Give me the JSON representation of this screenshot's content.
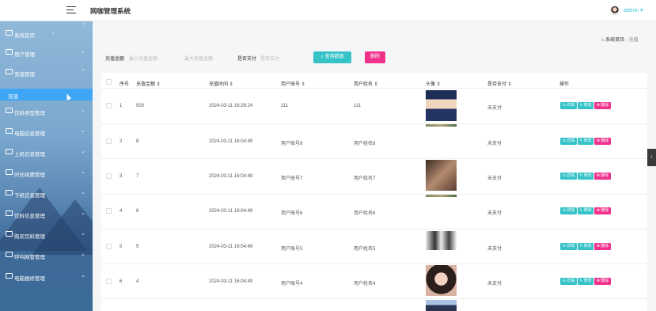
{
  "app": {
    "title": "网咖管理系统",
    "user": "admin ▾"
  },
  "sidebar": {
    "close": "×",
    "items": [
      {
        "label": "系统首页",
        "chevron": "⌄"
      },
      {
        "label": "用户管理",
        "chevron": "⌄"
      },
      {
        "label": "充值管理",
        "chevron": "⌃"
      },
      {
        "label": "饮料类型管理",
        "chevron": "⌄"
      },
      {
        "label": "电脑信息管理",
        "chevron": "⌄"
      },
      {
        "label": "上机信息管理",
        "chevron": "⌄"
      },
      {
        "label": "时长续费管理",
        "chevron": "⌄"
      },
      {
        "label": "下机信息管理",
        "chevron": "⌄"
      },
      {
        "label": "饮料信息管理",
        "chevron": "⌄"
      },
      {
        "label": "购买饮料管理",
        "chevron": "⌄"
      },
      {
        "label": "呼叫网管管理",
        "chevron": "⌄"
      },
      {
        "label": "电脑报修管理",
        "chevron": "⌄"
      }
    ],
    "sub": "充值"
  },
  "breadcrumb": {
    "home": "系统首页",
    "sep": "-",
    "current": "充值"
  },
  "filters": {
    "amount_label": "充值金额",
    "min_placeholder": "最小充值金额",
    "max_placeholder": "最大充值金额",
    "paid_label": "是否支付",
    "paid_placeholder": "是否支付",
    "search_button": "查询数据",
    "delete_button": "删除"
  },
  "table": {
    "headers": [
      "序号",
      "充值金额 ⇕",
      "充值时间 ⇕",
      "用户账号 ⇕",
      "用户姓名 ⇕",
      "头像 ⇕",
      "是否支付 ⇕",
      "操作"
    ],
    "rows": [
      {
        "no": "1",
        "amount": "500",
        "time": "2024-03-11 16:28:24",
        "account": "111",
        "name": "111",
        "paid": "未支付"
      },
      {
        "no": "2",
        "amount": "8",
        "time": "2024-03-11 16:04:49",
        "account": "用户账号8",
        "name": "用户姓名8",
        "paid": "未支付"
      },
      {
        "no": "3",
        "amount": "7",
        "time": "2024-03-11 16:04:49",
        "account": "用户账号7",
        "name": "用户姓名7",
        "paid": "未支付"
      },
      {
        "no": "4",
        "amount": "6",
        "time": "2024-03-11 16:04:49",
        "account": "用户账号6",
        "name": "用户姓名6",
        "paid": "未支付"
      },
      {
        "no": "5",
        "amount": "5",
        "time": "2024-03-11 16:04:49",
        "account": "用户账号5",
        "name": "用户姓名5",
        "paid": "未支付"
      },
      {
        "no": "6",
        "amount": "4",
        "time": "2024-03-11 16:04:49",
        "account": "用户账号4",
        "name": "用户姓名4",
        "paid": "未支付"
      }
    ],
    "actions": {
      "detail": "⊙ 详情",
      "edit": "✎ 修改",
      "delete": "⊗ 删除"
    }
  },
  "handle": "‹"
}
